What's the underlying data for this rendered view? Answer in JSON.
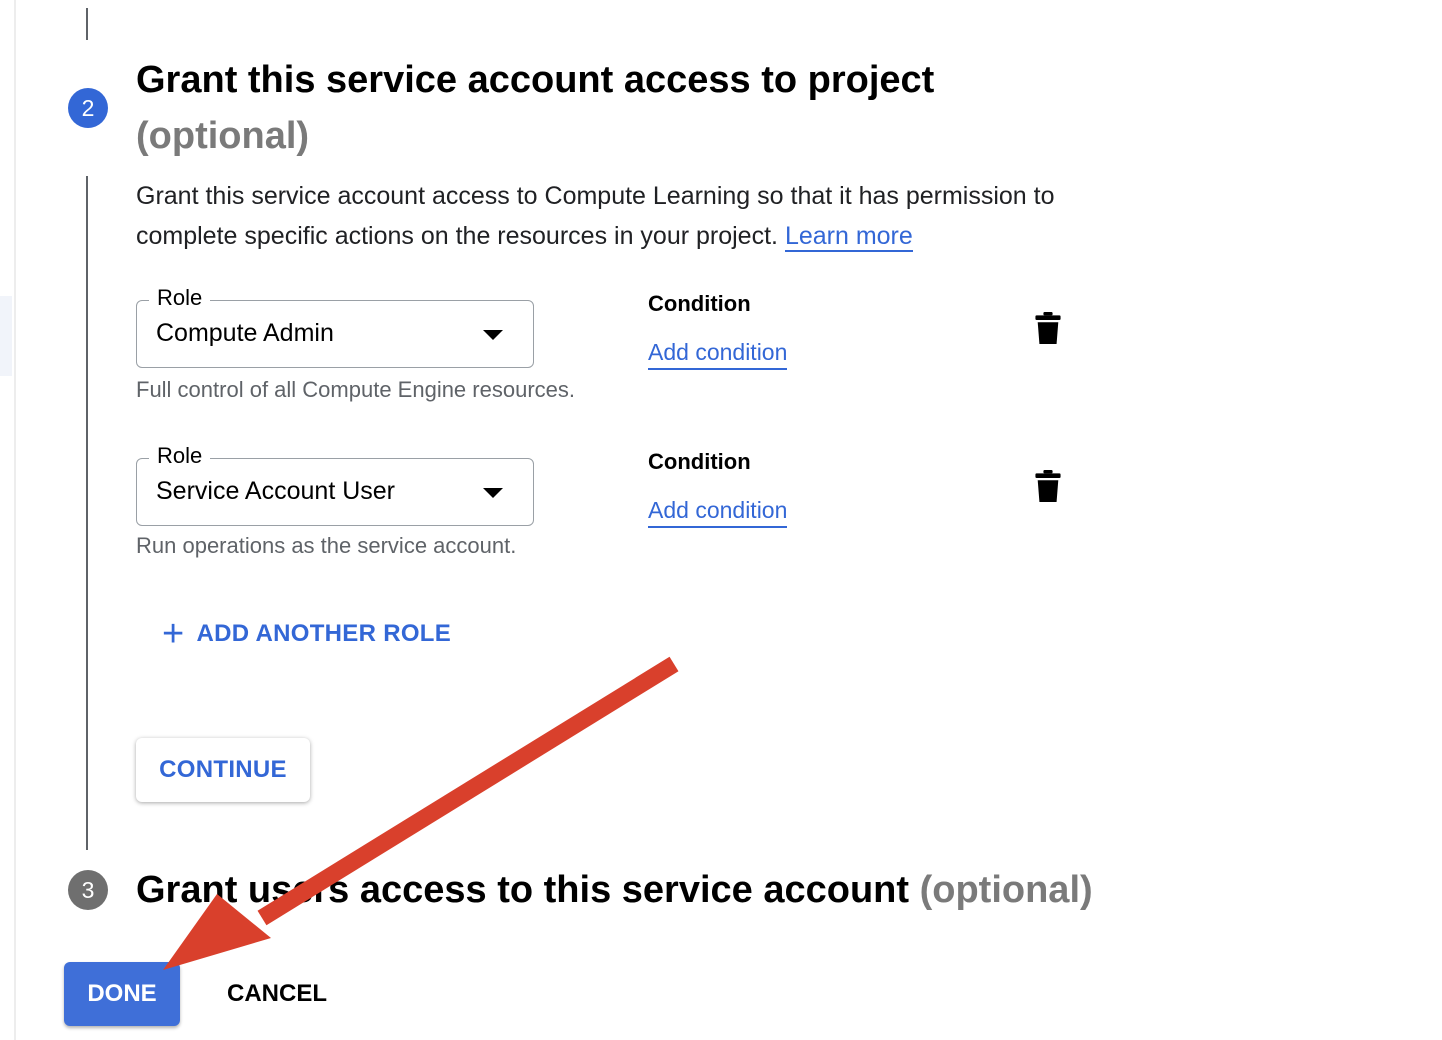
{
  "step2": {
    "number": "2",
    "title": "Grant this service account access to project",
    "optional": "(optional)",
    "description": "Grant this service account access to Compute Learning so that it has permission to complete specific actions on the resources in your project.",
    "learn_more": "Learn more",
    "roles": [
      {
        "label": "Role",
        "value": "Compute Admin",
        "hint": "Full control of all Compute Engine resources.",
        "condition_label": "Condition",
        "condition_link": "Add condition",
        "delete_icon": "trash-icon"
      },
      {
        "label": "Role",
        "value": "Service Account User",
        "hint": "Run operations as the service account.",
        "condition_label": "Condition",
        "condition_link": "Add condition",
        "delete_icon": "trash-icon"
      }
    ],
    "add_role_icon": "plus-icon",
    "add_role_label": "ADD ANOTHER ROLE",
    "continue_label": "CONTINUE"
  },
  "step3": {
    "number": "3",
    "title": "Grant users access to this service account",
    "optional": "(optional)"
  },
  "footer": {
    "done_label": "DONE",
    "cancel_label": "CANCEL"
  },
  "colors": {
    "accent": "#3367d6",
    "done_button": "#3f6fd8",
    "annotation_arrow": "#d9402c",
    "inactive_step": "#6f6f6f"
  }
}
